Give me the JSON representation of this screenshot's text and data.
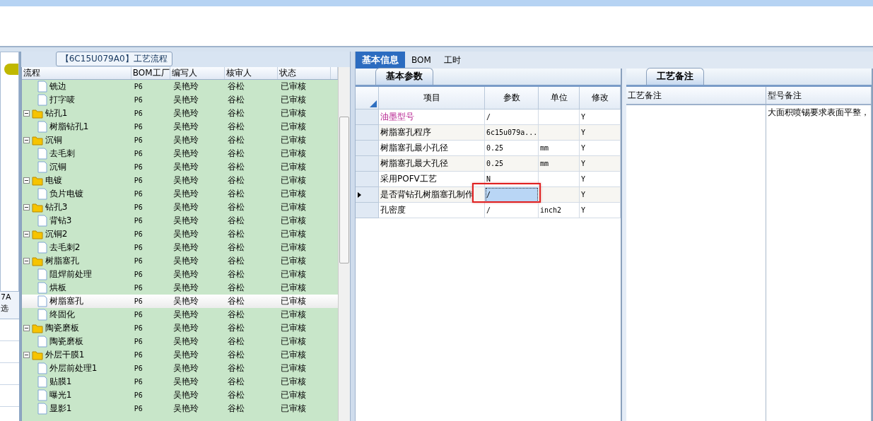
{
  "left_strip": {
    "texts": [
      "7A",
      "选"
    ]
  },
  "flow_panel": {
    "title": "【6C15U079A0】工艺流程",
    "columns": [
      "流程",
      "BOM工厂",
      "编写人",
      "核审人",
      "状态"
    ],
    "tree": [
      {
        "children": [
          {
            "label": "铣边",
            "factory": "P6",
            "author": "吴艳玲",
            "reviewer": "谷松",
            "status": "已审核",
            "selected": false
          },
          {
            "label": "打字唛",
            "factory": "P6",
            "author": "吴艳玲",
            "reviewer": "谷松",
            "status": "已审核",
            "selected": false
          }
        ]
      },
      {
        "label": "钻孔1",
        "factory": "P6",
        "author": "吴艳玲",
        "reviewer": "谷松",
        "status": "已审核",
        "selected": false,
        "expanded": true,
        "children": [
          {
            "label": "树脂钻孔1",
            "factory": "P6",
            "author": "吴艳玲",
            "reviewer": "谷松",
            "status": "已审核",
            "selected": false
          }
        ]
      },
      {
        "label": "沉铜",
        "factory": "P6",
        "author": "吴艳玲",
        "reviewer": "谷松",
        "status": "已审核",
        "selected": false,
        "expanded": true,
        "children": [
          {
            "label": "去毛刺",
            "factory": "P6",
            "author": "吴艳玲",
            "reviewer": "谷松",
            "status": "已审核",
            "selected": false
          },
          {
            "label": "沉铜",
            "factory": "P6",
            "author": "吴艳玲",
            "reviewer": "谷松",
            "status": "已审核",
            "selected": false
          }
        ]
      },
      {
        "label": "电镀",
        "factory": "P6",
        "author": "吴艳玲",
        "reviewer": "谷松",
        "status": "已审核",
        "selected": false,
        "expanded": true,
        "children": [
          {
            "label": "负片电镀",
            "factory": "P6",
            "author": "吴艳玲",
            "reviewer": "谷松",
            "status": "已审核",
            "selected": false
          }
        ]
      },
      {
        "label": "钻孔3",
        "factory": "P6",
        "author": "吴艳玲",
        "reviewer": "谷松",
        "status": "已审核",
        "selected": false,
        "expanded": true,
        "children": [
          {
            "label": "背钻3",
            "factory": "P6",
            "author": "吴艳玲",
            "reviewer": "谷松",
            "status": "已审核",
            "selected": false
          }
        ]
      },
      {
        "label": "沉铜2",
        "factory": "P6",
        "author": "吴艳玲",
        "reviewer": "谷松",
        "status": "已审核",
        "selected": false,
        "expanded": true,
        "children": [
          {
            "label": "去毛刺2",
            "factory": "P6",
            "author": "吴艳玲",
            "reviewer": "谷松",
            "status": "已审核",
            "selected": false
          }
        ]
      },
      {
        "label": "树脂塞孔",
        "factory": "P6",
        "author": "吴艳玲",
        "reviewer": "谷松",
        "status": "已审核",
        "selected": false,
        "expanded": true,
        "children": [
          {
            "label": "阻焊前处理",
            "factory": "P6",
            "author": "吴艳玲",
            "reviewer": "谷松",
            "status": "已审核",
            "selected": false
          },
          {
            "label": "烘板",
            "factory": "P6",
            "author": "吴艳玲",
            "reviewer": "谷松",
            "status": "已审核",
            "selected": false
          },
          {
            "label": "树脂塞孔",
            "factory": "P6",
            "author": "吴艳玲",
            "reviewer": "谷松",
            "status": "已审核",
            "selected": true
          },
          {
            "label": "终固化",
            "factory": "P6",
            "author": "吴艳玲",
            "reviewer": "谷松",
            "status": "已审核",
            "selected": false
          }
        ]
      },
      {
        "label": "陶瓷磨板",
        "factory": "P6",
        "author": "吴艳玲",
        "reviewer": "谷松",
        "status": "已审核",
        "selected": false,
        "expanded": true,
        "children": [
          {
            "label": "陶瓷磨板",
            "factory": "P6",
            "author": "吴艳玲",
            "reviewer": "谷松",
            "status": "已审核",
            "selected": false
          }
        ]
      },
      {
        "label": "外层干膜1",
        "factory": "P6",
        "author": "吴艳玲",
        "reviewer": "谷松",
        "status": "已审核",
        "selected": false,
        "expanded": true,
        "children": [
          {
            "label": "外层前处理1",
            "factory": "P6",
            "author": "吴艳玲",
            "reviewer": "谷松",
            "status": "已审核",
            "selected": false
          },
          {
            "label": "贴膜1",
            "factory": "P6",
            "author": "吴艳玲",
            "reviewer": "谷松",
            "status": "已审核",
            "selected": false
          },
          {
            "label": "曝光1",
            "factory": "P6",
            "author": "吴艳玲",
            "reviewer": "谷松",
            "status": "已审核",
            "selected": false
          },
          {
            "label": "显影1",
            "factory": "P6",
            "author": "吴艳玲",
            "reviewer": "谷松",
            "status": "已审核",
            "selected": false
          }
        ]
      }
    ]
  },
  "detail": {
    "tabs": [
      {
        "label": "基本信息",
        "selected": true
      },
      {
        "label": "BOM",
        "selected": false
      },
      {
        "label": "工时",
        "selected": false
      }
    ],
    "params": {
      "tab": "基本参数",
      "columns": [
        "项目",
        "参数",
        "单位",
        "修改"
      ],
      "rows": [
        {
          "item": "油墨型号",
          "value": "/",
          "modify": "Y",
          "highlighted": true,
          "current": false
        },
        {
          "item": "树脂塞孔程序",
          "value": "6c15u079a...",
          "modify": "Y",
          "highlighted": false,
          "current": false
        },
        {
          "item": "树脂塞孔最小孔径",
          "value": "0.25",
          "unit": "mm",
          "modify": "Y",
          "highlighted": false,
          "current": false
        },
        {
          "item": "树脂塞孔最大孔径",
          "value": "0.25",
          "unit": "mm",
          "modify": "Y",
          "highlighted": false,
          "current": false
        },
        {
          "item": "采用POFV工艺",
          "value": "N",
          "modify": "Y",
          "highlighted": false,
          "current": false
        },
        {
          "item": "是否背钻孔树脂塞孔制作",
          "value": "/",
          "modify": "Y",
          "highlighted": false,
          "current": true,
          "marked": true
        },
        {
          "item": "孔密度",
          "value": "/",
          "unit": "inch2",
          "modify": "Y",
          "highlighted": false,
          "current": false
        }
      ]
    },
    "notes": {
      "tab": "工艺备注",
      "columns": [
        "工艺备注",
        "型号备注"
      ],
      "model_note": "大面积喷锡要求表面平整，"
    }
  }
}
